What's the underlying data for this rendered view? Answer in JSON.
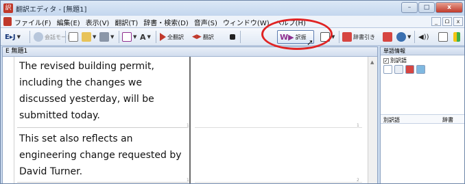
{
  "window": {
    "title": "翻訳エディタ - [無題1]",
    "controls": [
      "–",
      "□",
      "x"
    ]
  },
  "menu": {
    "items": [
      "ファイル(F)",
      "編集(E)",
      "表示(V)",
      "翻訳(T)",
      "辞書・検索(D)",
      "音声(S)",
      "ウィンドウ(W)",
      "ヘルプ(H)"
    ],
    "mdi_controls": [
      "_",
      "ᗝ",
      "x"
    ]
  },
  "toolbar": {
    "direction": "E▸J",
    "conference_mode": "会話モード",
    "full_translate": "全翻訳",
    "partial_translate": "翻訳",
    "alternates": "訳振",
    "dictionary_lookup": "辞書引き"
  },
  "document": {
    "tab_label": "E 無題1",
    "segments": [
      {
        "number": "1",
        "lines": [
          "The revised building permit,",
          "including the changes we",
          "discussed yesterday, will be",
          "submitted today."
        ]
      },
      {
        "number": "1",
        "lines": [
          "This set also reflects an",
          "engineering change requested by",
          "David Turner."
        ]
      }
    ],
    "target_numbers": [
      "1",
      "2",
      "2"
    ]
  },
  "side_panel": {
    "title": "単語情報",
    "checkbox_label": "別訳語",
    "checkbox_checked": true,
    "columns": [
      "別訳語",
      "辞書"
    ]
  },
  "colors": {
    "highlight": "#e02424",
    "title_bg": "#c3d6ee"
  }
}
